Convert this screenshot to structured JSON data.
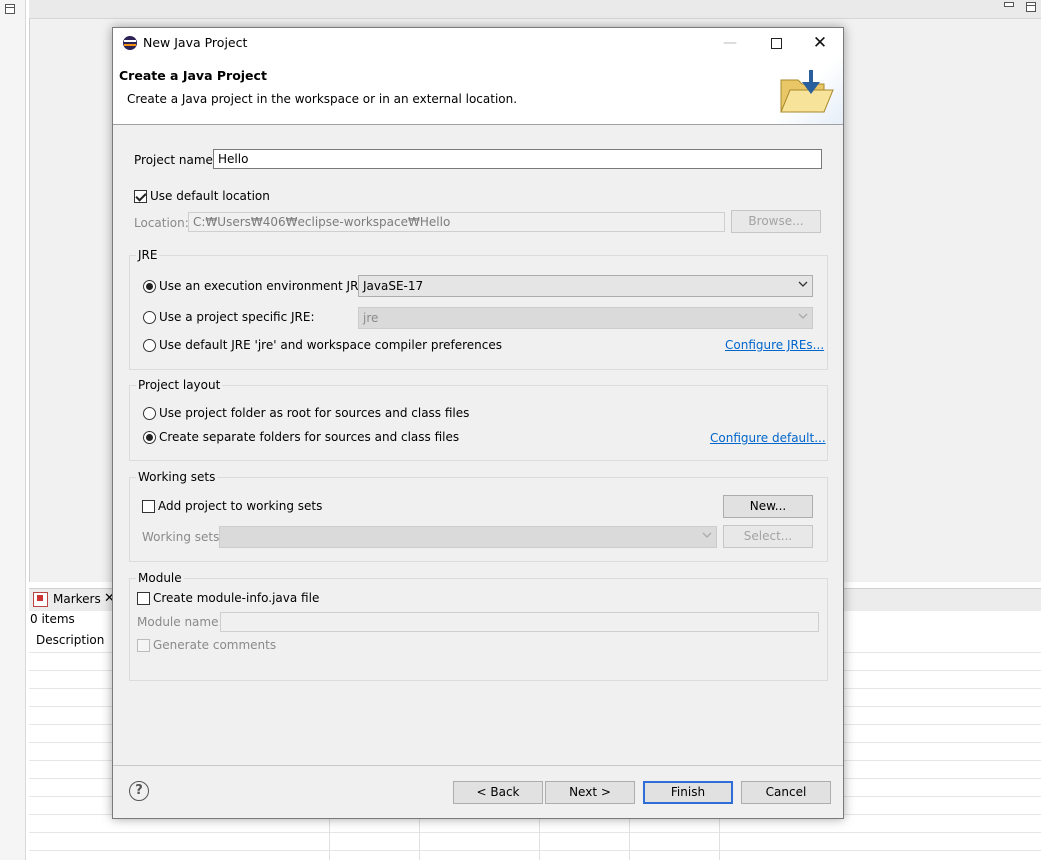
{
  "dialog": {
    "title": "New Java Project",
    "header_title": "Create a Java Project",
    "header_desc": "Create a Java project in the workspace or in an external location.",
    "icon": "eclipse-icon",
    "banner_icon": "folder-icon"
  },
  "project": {
    "name_label": "Project name:",
    "name_value": "Hello",
    "use_default_location_label": "Use default location",
    "use_default_location_checked": true,
    "location_label": "Location:",
    "location_value": "C:₩Users₩406₩eclipse-workspace₩Hello",
    "browse_label": "Browse..."
  },
  "jre": {
    "group_title": "JRE",
    "options": [
      {
        "label": "Use an execution environment JRE:",
        "selected": true
      },
      {
        "label": "Use a project specific JRE:",
        "selected": false
      },
      {
        "label": "Use default JRE 'jre' and workspace compiler preferences",
        "selected": false
      }
    ],
    "env_value": "JavaSE-17",
    "specific_value": "jre",
    "configure_link": "Configure JREs..."
  },
  "layout": {
    "group_title": "Project layout",
    "options": [
      {
        "label": "Use project folder as root for sources and class files",
        "selected": false
      },
      {
        "label": "Create separate folders for sources and class files",
        "selected": true
      }
    ],
    "configure_link": "Configure default..."
  },
  "working_sets": {
    "group_title": "Working sets",
    "add_label": "Add project to working sets",
    "add_checked": false,
    "new_label": "New...",
    "sets_label": "Working sets:",
    "select_label": "Select..."
  },
  "module": {
    "group_title": "Module",
    "create_label": "Create module-info.java file",
    "create_checked": false,
    "name_label": "Module name:",
    "generate_label": "Generate comments"
  },
  "footer": {
    "help": "?",
    "back": "< Back",
    "next": "Next >",
    "finish": "Finish",
    "cancel": "Cancel"
  },
  "background": {
    "markers_tab": "Markers",
    "items_count": "0 items",
    "column_description": "Description"
  },
  "colors": {
    "link": "#0066cc",
    "default_button_border": "#2f6ed6"
  }
}
